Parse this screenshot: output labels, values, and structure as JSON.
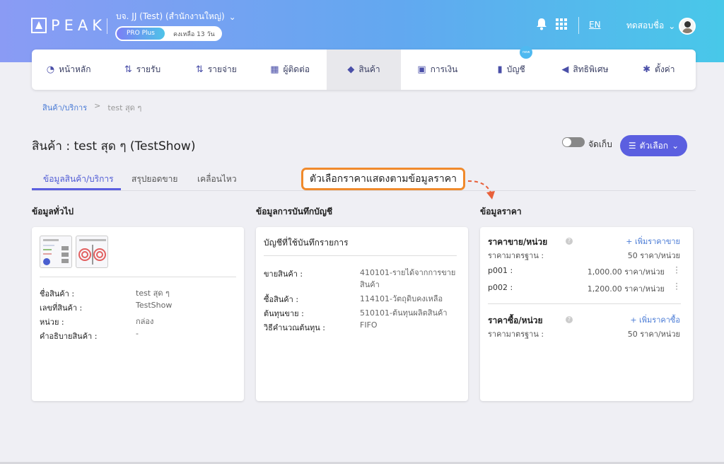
{
  "header": {
    "logo_text": "PEAK",
    "company": "บจ. JJ (Test) (สำนักงานใหญ่)",
    "plan": "PRO Plus",
    "plan_remaining": "คงเหลือ 13 วัน",
    "language": "EN",
    "user_name": "ทดสอบชื่อ"
  },
  "nav": {
    "items": [
      {
        "label": "หน้าหลัก",
        "icon": "dashboard-icon"
      },
      {
        "label": "รายรับ",
        "icon": "income-icon"
      },
      {
        "label": "รายจ่าย",
        "icon": "expense-icon"
      },
      {
        "label": "ผู้ติดต่อ",
        "icon": "contacts-icon"
      },
      {
        "label": "สินค้า",
        "icon": "box-icon"
      },
      {
        "label": "การเงิน",
        "icon": "money-icon"
      },
      {
        "label": "บัญชี",
        "icon": "book-icon",
        "badge": "new"
      },
      {
        "label": "สิทธิพิเศษ",
        "icon": "megaphone-icon"
      },
      {
        "label": "ตั้งค่า",
        "icon": "gear-icon"
      }
    ],
    "active_index": 4
  },
  "breadcrumb": {
    "link": "สินค้า/บริการ",
    "separator": ">",
    "current": "test สุด ๆ"
  },
  "page": {
    "title": "สินค้า : test สุด ๆ (TestShow)",
    "archive_label": "จัดเก็บ",
    "options_button": "ตัวเลือก"
  },
  "tabs": [
    "ข้อมูลสินค้า/บริการ",
    "สรุปยอดขาย",
    "เคลื่อนไหว"
  ],
  "callout": "ตัวเลือกราคาแสดงตามข้อมูลราคา",
  "general": {
    "heading": "ข้อมูลทั่วไป",
    "rows": [
      {
        "label": "ชื่อสินค้า :",
        "value": "test สุด ๆ"
      },
      {
        "label": "เลขที่สินค้า :",
        "value": "TestShow"
      },
      {
        "label": "หน่วย :",
        "value": "กล่อง"
      },
      {
        "label": "คำอธิบายสินค้า :",
        "value": "-"
      }
    ]
  },
  "accounting": {
    "heading": "ข้อมูลการบันทึกบัญชี",
    "card_title": "บัญชีที่ใช้บันทึกรายการ",
    "rows": [
      {
        "label": "ขายสินค้า :",
        "value": "410101-รายได้จากการขาย",
        "value2": "สินค้า"
      },
      {
        "label": "ซื้อสินค้า :",
        "value": "114101-วัตถุดิบคงเหลือ"
      },
      {
        "label": "ต้นทุนขาย :",
        "value": "510101-ต้นทุนผลิตสินค้า"
      },
      {
        "label": "วิธีคำนวณต้นทุน :",
        "value": "FIFO"
      }
    ]
  },
  "pricing": {
    "heading": "ข้อมูลราคา",
    "sell_title": "ราคาขาย/หน่วย",
    "sell_add": "+ เพิ่มราคาขาย",
    "sell_rows": [
      {
        "label": "ราคามาตรฐาน :",
        "value": "50 ราคา/หน่วย"
      },
      {
        "label": "p001 :",
        "value": "1,000.00 ราคา/หน่วย"
      },
      {
        "label": "p002 :",
        "value": "1,200.00 ราคา/หน่วย"
      }
    ],
    "buy_title": "ราคาซื้อ/หน่วย",
    "buy_add": "+ เพิ่มราคาซื้อ",
    "buy_rows": [
      {
        "label": "ราคามาตรฐาน :",
        "value": "50 ราคา/หน่วย"
      }
    ]
  }
}
